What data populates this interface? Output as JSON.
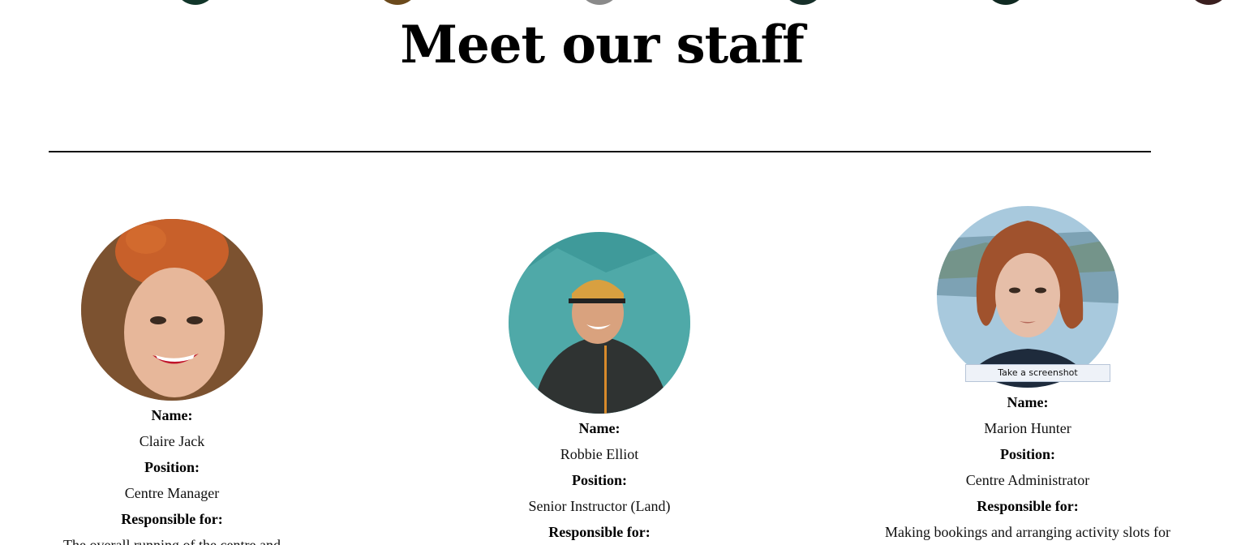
{
  "section_title": "Meet our staff",
  "labels": {
    "name": "Name:",
    "position": "Position:",
    "responsible": "Responsible for:"
  },
  "staff": [
    {
      "name": "Claire Jack",
      "position": "Centre Manager",
      "responsible": "The overall running of the centre and"
    },
    {
      "name": "Robbie Elliot",
      "position": "Senior Instructor (Land)",
      "responsible": ""
    },
    {
      "name": "Marion Hunter",
      "position": "Centre Administrator",
      "responsible": "Making bookings and arranging activity slots for"
    }
  ],
  "tooltip": "Take a screenshot",
  "top_dot_colors": [
    "#12362a",
    "#6b4a1c",
    "#8a8a8a",
    "#17302a",
    "#102a22",
    "#3a1f1f"
  ]
}
